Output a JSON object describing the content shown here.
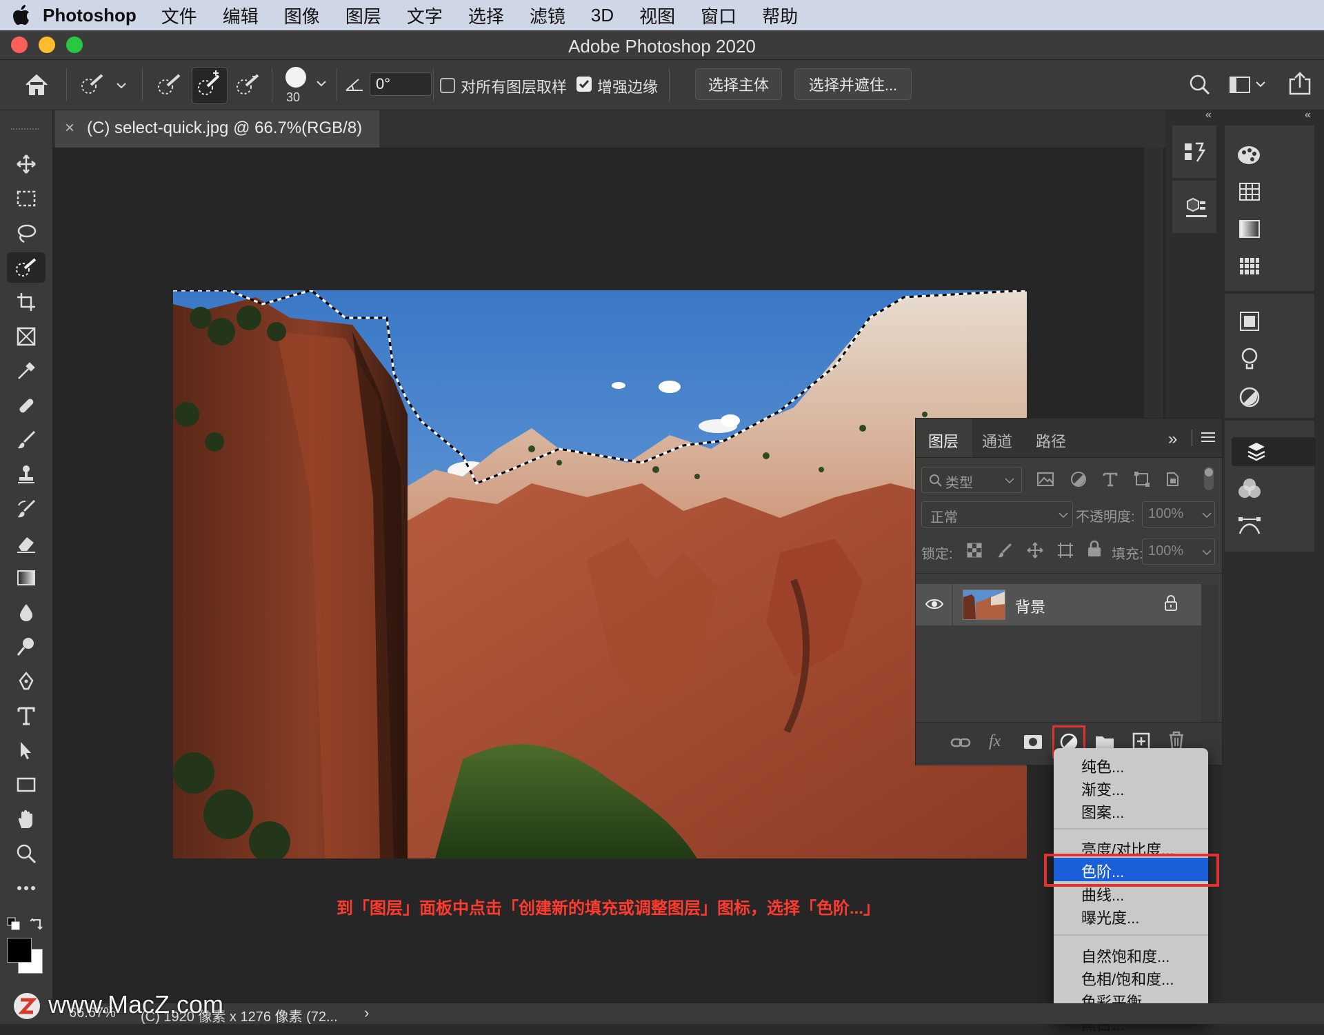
{
  "menubar": {
    "app_name": "Photoshop",
    "items": [
      "文件",
      "编辑",
      "图像",
      "图层",
      "文字",
      "选择",
      "滤镜",
      "3D",
      "视图",
      "窗口",
      "帮助"
    ]
  },
  "window": {
    "title": "Adobe Photoshop 2020"
  },
  "options": {
    "brush_size": "30",
    "angle": "0°",
    "sample_all_layers": {
      "label": "对所有图层取样",
      "checked": false
    },
    "enhance_edge": {
      "label": "增强边缘",
      "checked": true
    },
    "select_subject": "选择主体",
    "select_and_mask": "选择并遮住..."
  },
  "tab": {
    "close": "×",
    "title": "(C) select-quick.jpg @ 66.7%(RGB/8)"
  },
  "layers_panel": {
    "tabs": [
      "图层",
      "通道",
      "路径"
    ],
    "filter_placeholder": "类型",
    "blend_mode": "正常",
    "opacity_label": "不透明度:",
    "opacity_value": "100%",
    "lock_label": "锁定:",
    "fill_label": "填充:",
    "fill_value": "100%",
    "layer_name": "背景"
  },
  "adjust_menu": {
    "group1": [
      "纯色...",
      "渐变...",
      "图案..."
    ],
    "brightness": "亮度/对比度...",
    "levels": "色阶...",
    "curves": "曲线...",
    "exposure": "曝光度...",
    "group3": [
      "自然饱和度...",
      "色相/饱和度...",
      "色彩平衡...",
      "黑白..."
    ]
  },
  "annotation": "到「图层」面板中点击「创建新的填充或调整图层」图标，选择「色阶...」",
  "status": {
    "zoom": "66.67%",
    "doc_info": "(C) 1920 像素 x 1276 像素 (72...",
    "watermark": "www.MacZ.com"
  },
  "colors": {
    "highlight": "#1a5fd8",
    "callout_red": "#e0322e",
    "annotation_text": "#ff3b2f"
  }
}
